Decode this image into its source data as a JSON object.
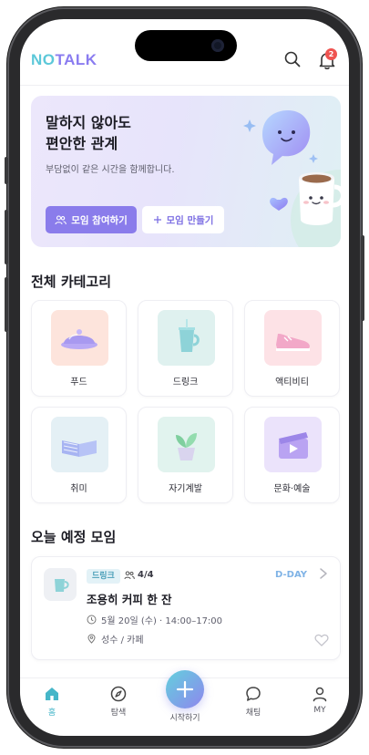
{
  "app": {
    "logo_part1": "NO",
    "logo_part2": "TALK"
  },
  "header": {
    "notification_count": "2"
  },
  "hero": {
    "title_line1": "말하지 않아도",
    "title_line2": "편안한 관계",
    "subtitle": "부담없이 같은 시간을 함께합니다.",
    "join_button": "모임 참여하기",
    "create_button": "모임 만들기"
  },
  "categories": {
    "title": "전체 카테고리",
    "items": [
      {
        "label": "푸드",
        "icon": "food-icon",
        "bg": "#fde4dc"
      },
      {
        "label": "드링크",
        "icon": "drink-icon",
        "bg": "#dff1ef"
      },
      {
        "label": "액티비티",
        "icon": "sneaker-icon",
        "bg": "#fde2e6"
      },
      {
        "label": "취미",
        "icon": "book-icon",
        "bg": "#e4f0f5"
      },
      {
        "label": "자기계발",
        "icon": "plant-icon",
        "bg": "#e1f3ee"
      },
      {
        "label": "문화·예술",
        "icon": "film-icon",
        "bg": "#ebe3fb"
      }
    ]
  },
  "today": {
    "title": "오늘 예정 모임",
    "meeting": {
      "tag": "드링크",
      "people": "4/4",
      "dday": "D-DAY",
      "title": "조용히 커피 한 잔",
      "datetime": "5월 20일 (수) · 14:00–17:00",
      "location": "성수 / 카페"
    }
  },
  "nav": {
    "home": "홈",
    "explore": "탐색",
    "start": "시작하기",
    "chat": "채팅",
    "my": "MY"
  },
  "colors": {
    "accent": "#8a7ceb",
    "teal": "#45b6c8",
    "badge": "#ef5350"
  }
}
